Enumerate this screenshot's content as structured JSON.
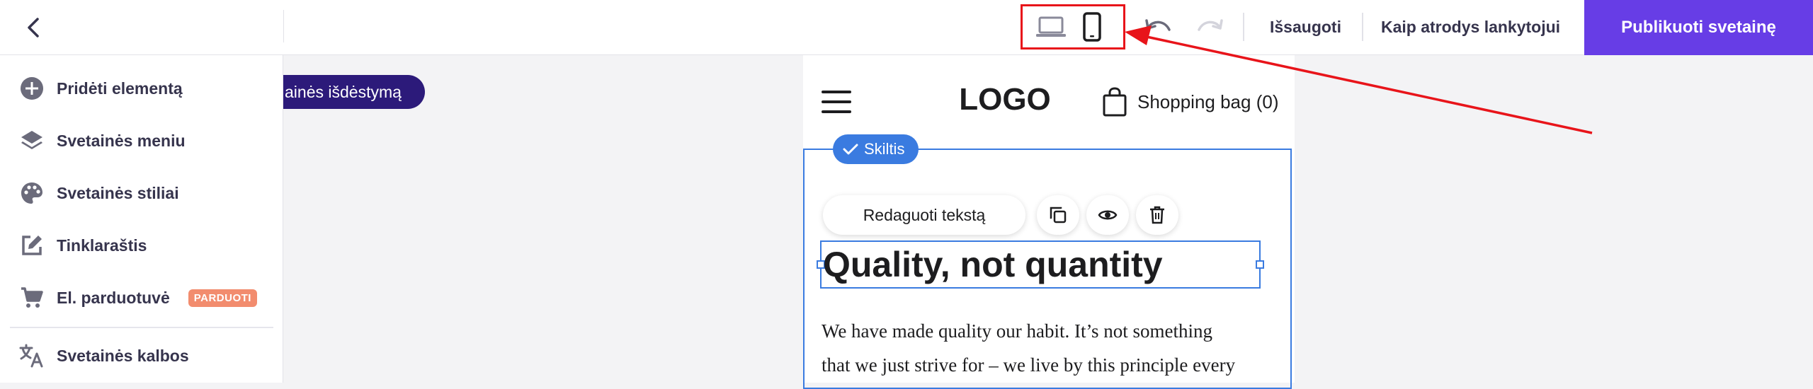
{
  "topbar": {
    "save_label": "Išsaugoti",
    "preview_label": "Kaip atrodys lankytojui",
    "publish_label": "Publikuoti svetainę"
  },
  "sidebar": {
    "items": [
      {
        "label": "Pridėti elementą",
        "icon": "plus-circle-icon"
      },
      {
        "label": "Svetainės meniu",
        "icon": "layers-icon"
      },
      {
        "label": "Svetainės stiliai",
        "icon": "palette-icon"
      },
      {
        "label": "Tinklaraštis",
        "icon": "edit-icon"
      },
      {
        "label": "El. parduotuvė",
        "icon": "cart-icon",
        "badge": "PARDUOTI"
      },
      {
        "label": "Svetainės kalbos",
        "icon": "translate-icon"
      }
    ]
  },
  "canvas": {
    "layout_pill": "ainės išdėstymą"
  },
  "preview": {
    "logo": "LOGO",
    "bag_label": "Shopping bag (0)",
    "section_badge": "Skiltis",
    "edit_text_label": "Redaguoti tekstą",
    "heading": "Quality, not quantity",
    "body_line1": "We have made quality our habit. It’s not something",
    "body_line2": "that we just strive for – we live by this principle every"
  },
  "colors": {
    "accent": "#673de6",
    "selection": "#3a7be0",
    "annotation": "#e8141a",
    "badge": "#f28c6e"
  }
}
